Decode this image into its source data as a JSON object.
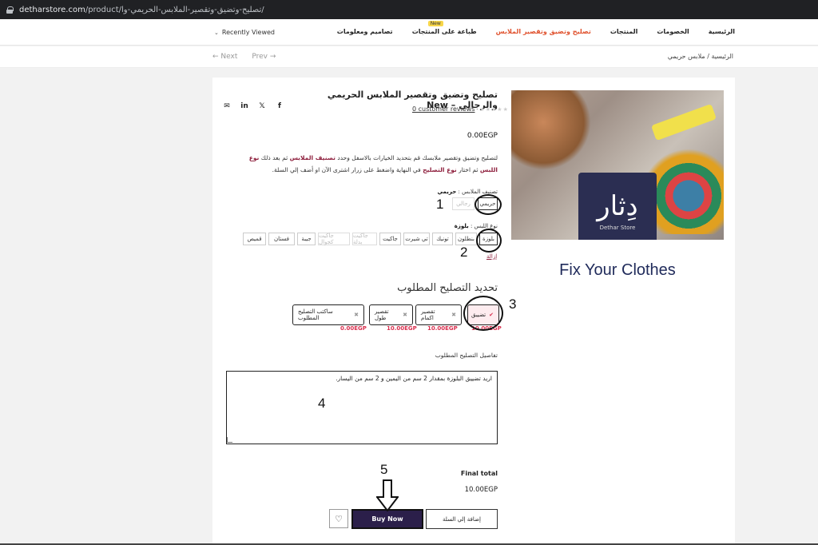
{
  "browser": {
    "url_domain": "detharstore.com",
    "url_path": "/product/تصليح-وتضيق-وتقصير-الملابس-الحريمي-وا/"
  },
  "header": {
    "recently_viewed": "Recently Viewed",
    "menu": [
      {
        "label": "الرئيسية"
      },
      {
        "label": "الخصومات"
      },
      {
        "label": "المنتجات"
      },
      {
        "label": "تصليح وتضيق وتقصير الملابس",
        "active": true
      },
      {
        "label": "طباعة على المنتجات",
        "badge": "New"
      },
      {
        "label": "تصاميم ومعلومات"
      }
    ]
  },
  "subnav": {
    "next": "← Next",
    "prev": "Prev →",
    "breadcrumb": "الرئيسية / ملابس حريمي"
  },
  "product": {
    "title": "تصليح وتضيق وتقصير الملابس الحريمي والرجالي – New",
    "reviews": "0 customer reviews",
    "stars": "★★★★★",
    "price": "0.00EGP",
    "image_brand": "دِثار",
    "image_brand_en": "Dethar Store",
    "image_caption": "Fix Your Clothes",
    "description_parts": [
      "لتصليح وتضيق وتقصير ملابسك قم بتحديد الخيارات بالاسفل وحدد ",
      "تصنيف الملابس",
      " ثم بعد ذلك ",
      "نوع اللبس",
      " ثم اختار ",
      "نوع التصليح",
      " في النهاية واضغط على زرار اشترى الآن او أضف إلي السلة."
    ]
  },
  "options": {
    "category_label": "تصنيف الملابس :",
    "category_value": "حريمي",
    "categories": [
      {
        "label": "حريمي",
        "selected": true
      },
      {
        "label": "رجالي",
        "disabled": true
      }
    ],
    "type_label": "نوع اللبس :",
    "type_value": "بلوزة",
    "types": [
      {
        "label": "بلوزة",
        "selected": true
      },
      {
        "label": "بنطلون"
      },
      {
        "label": "تونيك"
      },
      {
        "label": "تي شيرت"
      },
      {
        "label": "جاكيت"
      },
      {
        "label": "جاكيت بدلة",
        "disabled": true
      },
      {
        "label": "جاكيت كجوال",
        "disabled": true
      },
      {
        "label": "جيبة"
      },
      {
        "label": "فستان"
      },
      {
        "label": "قميص"
      }
    ],
    "clear": "إزالة"
  },
  "repair": {
    "title": "تحديد التصليح المطلوب",
    "services": [
      {
        "label": "تضييق",
        "price": "10.00EGP",
        "selected": true
      },
      {
        "label": "تقصير اكمام",
        "price": "10.00EGP"
      },
      {
        "label": "تقصير طول",
        "price": "10.00EGP"
      },
      {
        "label": "ساكتب التصليح المطلوب",
        "price": "0.00EGP"
      }
    ],
    "details_label": "تفاصيل التصليح المطلوب",
    "details_value": "اريد تضييق البلوزة بمقدار 2 سم من اليمين و 2 سم من اليسار."
  },
  "total": {
    "label": "Final total",
    "value": "10.00EGP"
  },
  "actions": {
    "buy_now": "Buy Now",
    "add_to_cart": "إضافة إلي السلة"
  },
  "annotations": [
    "1",
    "2",
    "3",
    "4",
    "5"
  ],
  "colors": {
    "accent": "#e0522e",
    "brand_dark": "#2b2e52",
    "highlight": "#8e1f3d",
    "price_red": "#d9304f"
  }
}
